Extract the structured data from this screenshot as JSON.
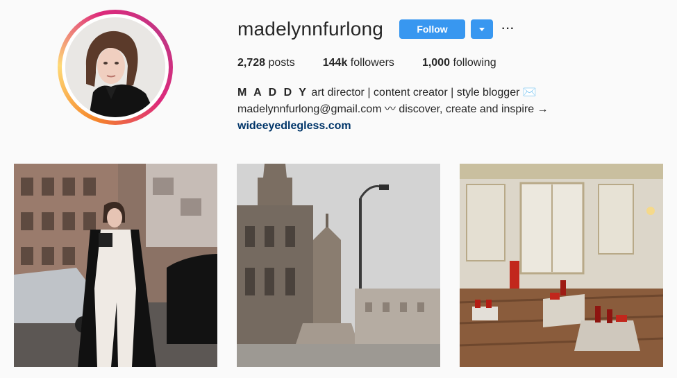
{
  "profile": {
    "username": "madelynnfurlong",
    "follow_label": "Follow",
    "avatar_icon": "profile-photo",
    "dropdown_icon": "caret-down-icon",
    "more_label": "···"
  },
  "stats": {
    "posts_count": "2,728",
    "posts_label": "posts",
    "followers_count": "144k",
    "followers_label": "followers",
    "following_count": "1,000",
    "following_label": "following"
  },
  "bio": {
    "name": "M A D D Y",
    "line1_rest": " art director | content creator | style blogger ✉️",
    "line2": "madelynnfurlong@gmail.com 〰 discover, create and inspire →",
    "link": "wideeyedlegless.com"
  },
  "posts": [
    {
      "subject": "woman-in-white-outfit-street"
    },
    {
      "subject": "church-tower-and-fountain"
    },
    {
      "subject": "ornate-white-room-shoes"
    }
  ],
  "colors": {
    "accent": "#3897f0",
    "link": "#003569",
    "text": "#262626",
    "background": "#fafafa"
  }
}
